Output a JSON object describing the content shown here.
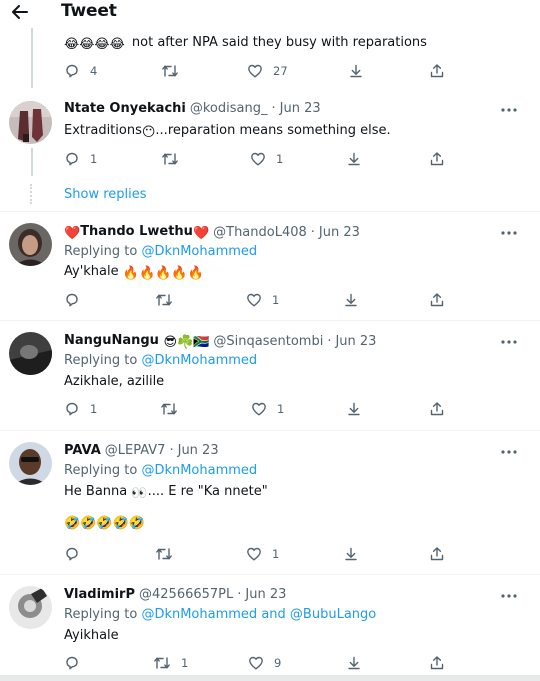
{
  "header": {
    "title": "Tweet"
  },
  "top_tweet": {
    "text": "not after NPA said they busy with reparations",
    "emoji": "😂😂😂😂",
    "replies": "4",
    "likes": "27"
  },
  "show_replies": "Show replies",
  "replying_label": "Replying to",
  "tweets": [
    {
      "name": "Ntate Onyekachi",
      "handle": "@kodisang_",
      "date": "Jun 23",
      "text_pre": "Extraditions",
      "emoji": "😶",
      "text_post": "...reparation means something else.",
      "replies": "1",
      "likes": "1"
    },
    {
      "name_emoji_l": "❤️",
      "name": "Thando Lwethu",
      "name_emoji_r": "❤️",
      "handle": "@ThandoL408",
      "date": "Jun 23",
      "mention": "@DknMohammed",
      "text": "Ay'khale",
      "emoji": "🔥🔥🔥🔥🔥",
      "likes": "1"
    },
    {
      "name": "NanguNangu",
      "name_emoji": "😎☘️🇿🇦",
      "handle": "@Sinqasentombi",
      "date": "Jun 23",
      "mention": "@DknMohammed",
      "text": "Azikhale, azilile",
      "replies": "1",
      "likes": "1"
    },
    {
      "name": "PAVA",
      "handle": "@LEPAV7",
      "date": "Jun 23",
      "mention": "@DknMohammed",
      "text_pre": "He Banna",
      "emoji": "👀",
      "text_post": ".... E re \"Ka nnete\"",
      "emoji_line": "🤣🤣🤣🤣🤣",
      "likes": "1"
    },
    {
      "name": "VladimirP",
      "handle": "@42566657PL",
      "date": "Jun 23",
      "mention1": "@DknMohammed",
      "and_word": "and",
      "mention2": "@BubuLango",
      "text": "Ayikhale",
      "retweets": "1",
      "likes": "9"
    }
  ],
  "icons": {
    "back": "back-arrow-icon",
    "reply": "reply-icon",
    "retweet": "retweet-icon",
    "like": "like-icon",
    "bookmark": "bookmark-icon",
    "share": "share-icon",
    "more": "more-icon"
  },
  "colors": {
    "accent": "#1d9bf0",
    "secondary_text": "#536471",
    "primary_text": "#0f1419"
  }
}
